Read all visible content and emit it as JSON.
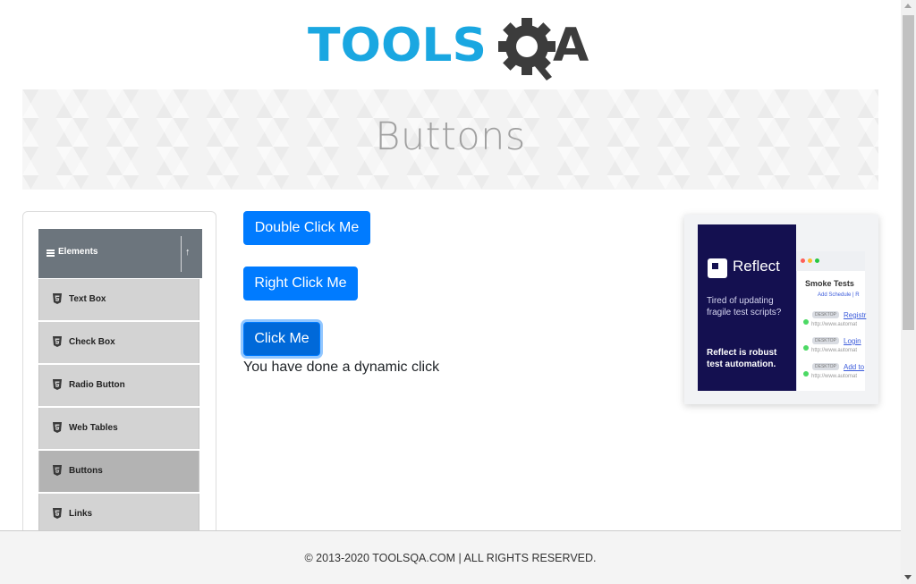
{
  "logo": {
    "text_left": "TOOLS",
    "text_right": "QA",
    "color_left": "#1aa7e1",
    "color_right": "#3c3c3c"
  },
  "banner": {
    "title": "Buttons"
  },
  "sidebar": {
    "group_label": "Elements",
    "group_icon": "menu-icon",
    "collapse_icon": "arrow-up-icon",
    "items": [
      {
        "label": "Text Box",
        "icon": "html5-icon"
      },
      {
        "label": "Check Box",
        "icon": "html5-icon"
      },
      {
        "label": "Radio Button",
        "icon": "html5-icon"
      },
      {
        "label": "Web Tables",
        "icon": "html5-icon"
      },
      {
        "label": "Buttons",
        "icon": "html5-icon",
        "active": true
      },
      {
        "label": "Links",
        "icon": "html5-icon"
      }
    ]
  },
  "main": {
    "double_click_label": "Double Click Me",
    "right_click_label": "Right Click Me",
    "click_label": "Click Me",
    "dynamic_message": "You have done a dynamic click",
    "button_color": "#007bff"
  },
  "ad": {
    "brand": "Reflect",
    "tagline": "Tired of updating fragile test scripts?",
    "claim": "Reflect is robust test automation.",
    "panel_title": "Smoke Tests",
    "panel_link": "Add Schedule  |  R",
    "rows": [
      {
        "tag": "DESKTOP",
        "name": "Registr",
        "url": "http://www.automat"
      },
      {
        "tag": "DESKTOP",
        "name": "Login",
        "url": "http://www.automat"
      },
      {
        "tag": "DESKTOP",
        "name": "Add to",
        "url": "http://www.automat"
      }
    ]
  },
  "footer": {
    "text": "© 2013-2020 TOOLSQA.COM | ALL RIGHTS RESERVED."
  }
}
